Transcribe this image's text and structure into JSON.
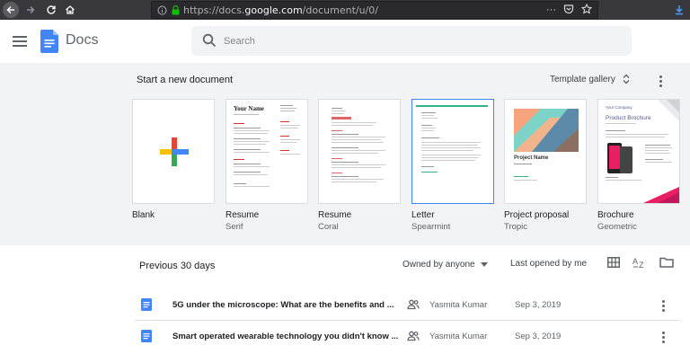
{
  "browser": {
    "url_prefix": "https://docs.",
    "url_host": "google.com",
    "url_path": "/document/u/0/"
  },
  "header": {
    "app_title": "Docs",
    "search_placeholder": "Search"
  },
  "templates": {
    "section_title": "Start a new document",
    "gallery_label": "Template gallery",
    "items": [
      {
        "name": "Blank",
        "sub": ""
      },
      {
        "name": "Resume",
        "sub": "Serif"
      },
      {
        "name": "Resume",
        "sub": "Coral"
      },
      {
        "name": "Letter",
        "sub": "Spearmint"
      },
      {
        "name": "Project proposal",
        "sub": "Tropic"
      },
      {
        "name": "Brochure",
        "sub": "Geometric"
      }
    ],
    "thumb_text": {
      "serif_heading": "Your Name",
      "tropic_heading": "Project Name",
      "brochure_company": "Your Company",
      "brochure_heading": "Product Brochure"
    }
  },
  "recent": {
    "section_title": "Previous 30 days",
    "owner_filter": "Owned by anyone",
    "sort_label": "Last opened by me",
    "documents": [
      {
        "title": "5G under the microscope: What are the benefits and ...",
        "owner": "Yasmita Kumar",
        "date": "Sep 3, 2019"
      },
      {
        "title": "Smart operated wearable technology you didn't know ...",
        "owner": "Yasmita Kumar",
        "date": "Sep 3, 2019"
      }
    ]
  },
  "colors": {
    "docs_blue": "#4285f4",
    "google_red": "#ea4335",
    "google_yellow": "#fbbc04",
    "google_green": "#34a853",
    "template_bg": "#f1f3f4",
    "spearmint": "#34b38a",
    "coral": "#e06666",
    "brochure_pink": "#e91e63"
  },
  "icons": [
    "back-arrow-icon",
    "forward-arrow-icon",
    "reload-icon",
    "home-icon",
    "info-icon",
    "lock-icon",
    "download-icon",
    "menu-icon",
    "search-icon",
    "unfold-icon",
    "more-vert-icon",
    "grid-view-icon",
    "sort-az-icon",
    "folder-icon",
    "doc-file-icon",
    "shared-people-icon"
  ]
}
